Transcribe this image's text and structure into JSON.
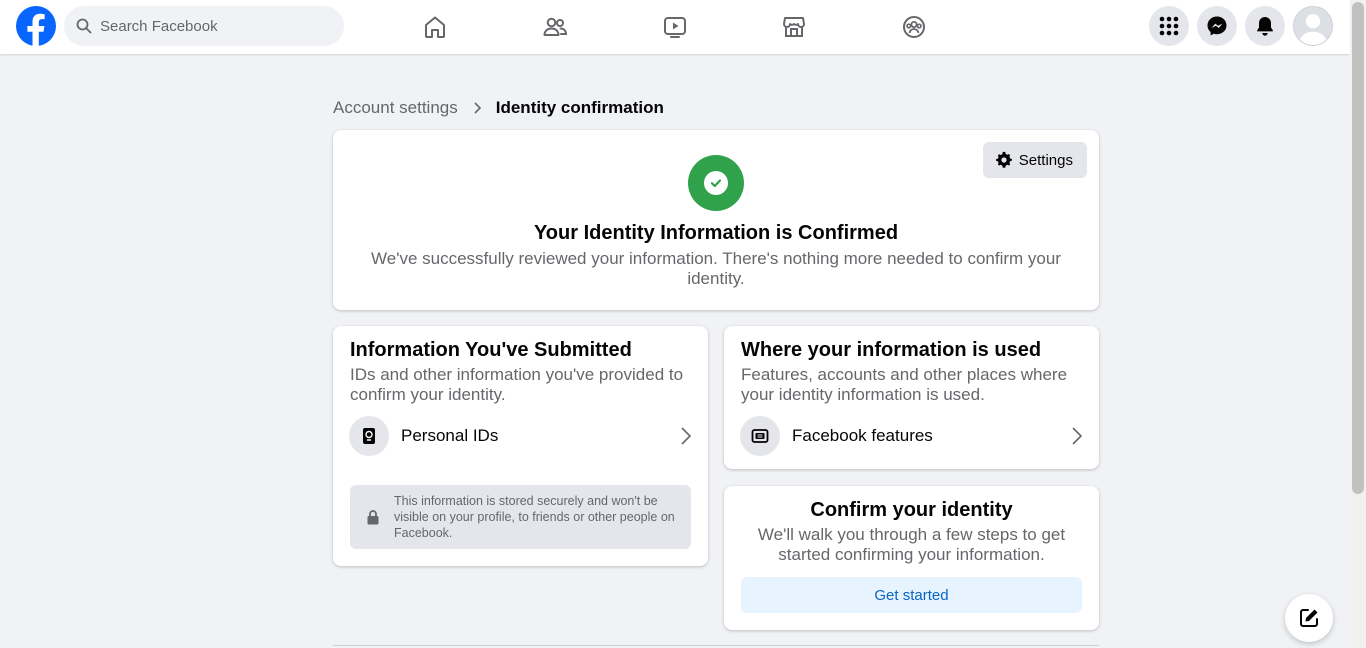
{
  "header": {
    "search_placeholder": "Search Facebook",
    "nav_icons": [
      "home-icon",
      "friends-icon",
      "watch-icon",
      "marketplace-icon",
      "groups-icon"
    ],
    "right_icons": [
      "menu-grid-icon",
      "messenger-icon",
      "notifications-icon"
    ]
  },
  "breadcrumb": {
    "parent": "Account settings",
    "current": "Identity confirmation"
  },
  "confirmed_card": {
    "settings_label": "Settings",
    "title": "Your Identity Information is Confirmed",
    "description": "We've successfully reviewed your information. There's nothing more needed to confirm your identity."
  },
  "submitted_card": {
    "title": "Information You've Submitted",
    "description": "IDs and other information you've provided to confirm your identity.",
    "item_label": "Personal IDs",
    "secure_note": "This information is stored securely and won't be visible on your profile, to friends or other people on Facebook."
  },
  "used_card": {
    "title": "Where your information is used",
    "description": "Features, accounts and other places where your identity information is used.",
    "item_label": "Facebook features"
  },
  "start_card": {
    "title": "Confirm your identity",
    "description": "We'll walk you through a few steps to get started confirming your information.",
    "button_label": "Get started"
  },
  "colors": {
    "brand": "#0866ff",
    "success": "#31a24c",
    "link_button_bg": "#e7f3ff",
    "link_button_text": "#0a66c2"
  }
}
